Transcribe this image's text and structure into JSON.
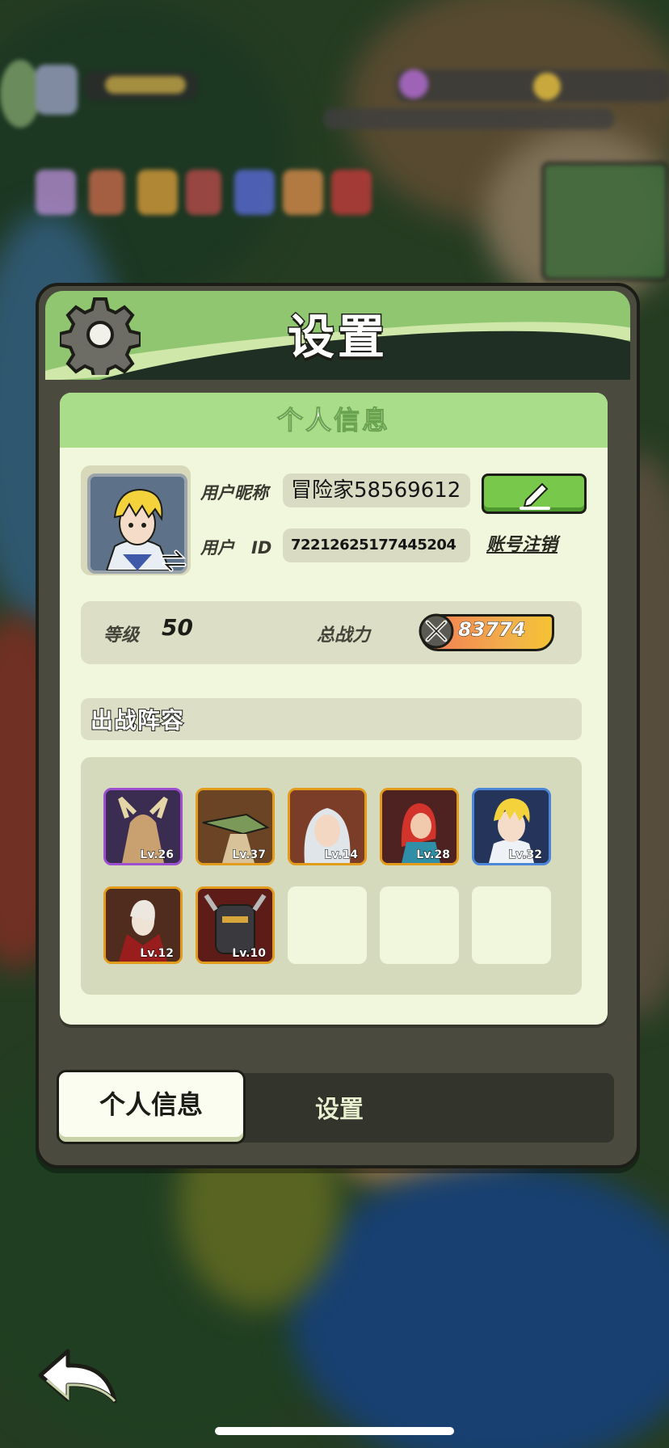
{
  "dialog": {
    "title": "设置",
    "personal_info_header": "个人信息",
    "nickname_label": "用户昵称",
    "nickname_value": "冒险家58569612",
    "id_label": "用户　ID",
    "id_value": "72212625177445204",
    "cancel_account_label": "账号注销",
    "level_label": "等级",
    "level_value": "50",
    "power_label": "总战力",
    "power_value": "83774",
    "lineup_title": "出战阵容"
  },
  "lineup": {
    "heroes": [
      {
        "level": "Lv.26",
        "rarity_color": "#9d4fd0"
      },
      {
        "level": "Lv.37",
        "rarity_color": "#e39b1c"
      },
      {
        "level": "Lv.14",
        "rarity_color": "#e39b1c"
      },
      {
        "level": "Lv.28",
        "rarity_color": "#e39b1c"
      },
      {
        "level": "Lv.32",
        "rarity_color": "#4b86d8"
      },
      {
        "level": "Lv.12",
        "rarity_color": "#e39b1c"
      },
      {
        "level": "Lv.10",
        "rarity_color": "#e39b1c"
      }
    ],
    "empty_slots": 3
  },
  "tabs": [
    {
      "label": "个人信息",
      "active": true
    },
    {
      "label": "设置",
      "active": false
    }
  ],
  "icons": {
    "gear": "gear-icon",
    "edit": "pencil-icon",
    "swap": "swap-arrows-icon",
    "power": "crossed-swords-icon",
    "back": "back-arrow-icon"
  }
}
